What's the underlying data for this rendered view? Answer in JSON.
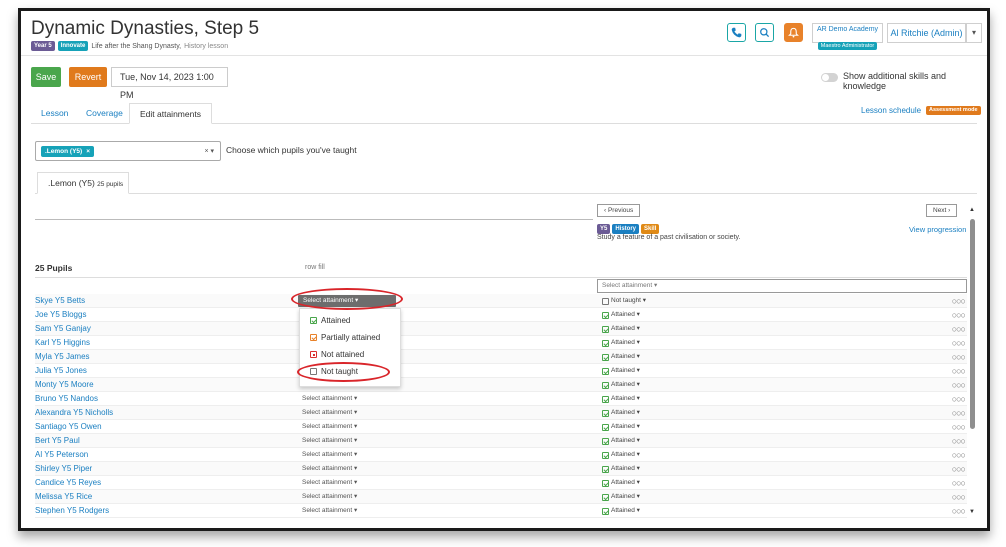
{
  "header": {
    "title": "Dynamic Dynasties, Step 5",
    "year_badge": "Year 5",
    "innovate_badge": "Innovate",
    "subtitle": "Life after the Shang Dynasty,",
    "subject": "History lesson",
    "org_name": "AR Demo Academy",
    "org_role": "Maestro Administrator",
    "user_name": "Al Ritchie (Admin)"
  },
  "toolbar": {
    "save_label": "Save",
    "revert_label": "Revert",
    "date_value": "Tue, Nov 14, 2023 1:00 PM",
    "toggle_label": "Show additional skills and knowledge"
  },
  "tabs": [
    {
      "label": "Lesson"
    },
    {
      "label": "Coverage"
    },
    {
      "label": "Edit attainments"
    }
  ],
  "lesson_schedule": "Lesson schedule",
  "assessment_badge": "Assessment mode",
  "pupil_select": {
    "chip": ".Lemon (Y5)",
    "clear": "×",
    "caret": "▾",
    "label": "Choose which pupils you've taught"
  },
  "class_tab": {
    "name": ".Lemon (Y5)",
    "count": "25 pupils"
  },
  "grid": {
    "previous": "‹  Previous",
    "next": "Next  ›",
    "obj_year": "Y5",
    "obj_subject": "History",
    "obj_type": "Skill",
    "objective": "Study a feature of a past civilisation or society.",
    "view_progression": "View progression",
    "count_label": "25 Pupils",
    "row_fill": "row fill",
    "fill_select": "Select attainment ▾",
    "select_label": "Select attainment ▾",
    "attained_label": "Attained ▾",
    "not_taught_label": "Not taught ▾",
    "circles": "○○○"
  },
  "dropdown": {
    "attained": "Attained",
    "partial": "Partially attained",
    "not_attained": "Not attained",
    "not_taught": "Not taught"
  },
  "pupils": [
    {
      "name": "Skye Y5 Betts"
    },
    {
      "name": "Joe Y5 Bloggs"
    },
    {
      "name": "Sam Y5 Ganjay"
    },
    {
      "name": "Karl Y5 Higgins"
    },
    {
      "name": "Myla Y5 James"
    },
    {
      "name": "Julia Y5 Jones"
    },
    {
      "name": "Monty Y5 Moore"
    },
    {
      "name": "Bruno Y5 Nandos"
    },
    {
      "name": "Alexandra Y5 Nicholls"
    },
    {
      "name": "Santiago Y5 Owen"
    },
    {
      "name": "Bert Y5 Paul"
    },
    {
      "name": "Al Y5 Peterson"
    },
    {
      "name": "Shirley Y5 Piper"
    },
    {
      "name": "Candice Y5 Reyes"
    },
    {
      "name": "Melissa Y5 Rice"
    },
    {
      "name": "Stephen Y5 Rodgers"
    }
  ],
  "colors": {
    "teal": "#16a2b8",
    "link": "#1a7fc1",
    "save": "#4aa64c",
    "revert": "#e07a1c",
    "annotation": "#d9252a"
  }
}
